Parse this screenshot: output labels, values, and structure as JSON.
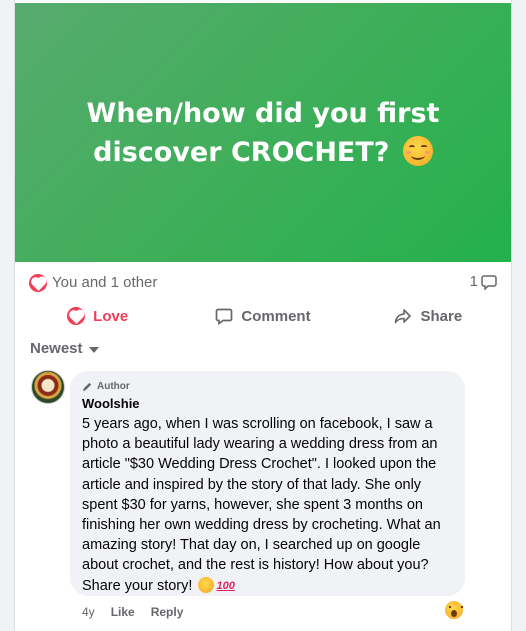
{
  "post": {
    "image_text": "When/how did you first discover CROCHET?"
  },
  "reactions": {
    "summary": "You and 1 other",
    "comment_count": "1"
  },
  "actions": {
    "love": "Love",
    "comment": "Comment",
    "share": "Share"
  },
  "sort": {
    "label": "Newest"
  },
  "comment": {
    "badge": "Author",
    "author": "Woolshie",
    "text": "5 years ago, when I was scrolling on facebook, I saw a photo a beautiful lady wearing a wedding dress from an article \"$30 Wedding Dress Crochet\". I looked upon the article and inspired by the story of that lady. She only spent $30 for yarns, however, she spent 3 months on finishing her own wedding dress by crocheting. What an amazing story! That day on, I searched up on google about crochet, and the rest is history! How about you? Share your story!",
    "hundred": "100",
    "time": "4y",
    "like": "Like",
    "reply": "Reply"
  },
  "colors": {
    "love": "#f33e58",
    "post_bg": "#2fb04f",
    "muted": "#65676b"
  }
}
